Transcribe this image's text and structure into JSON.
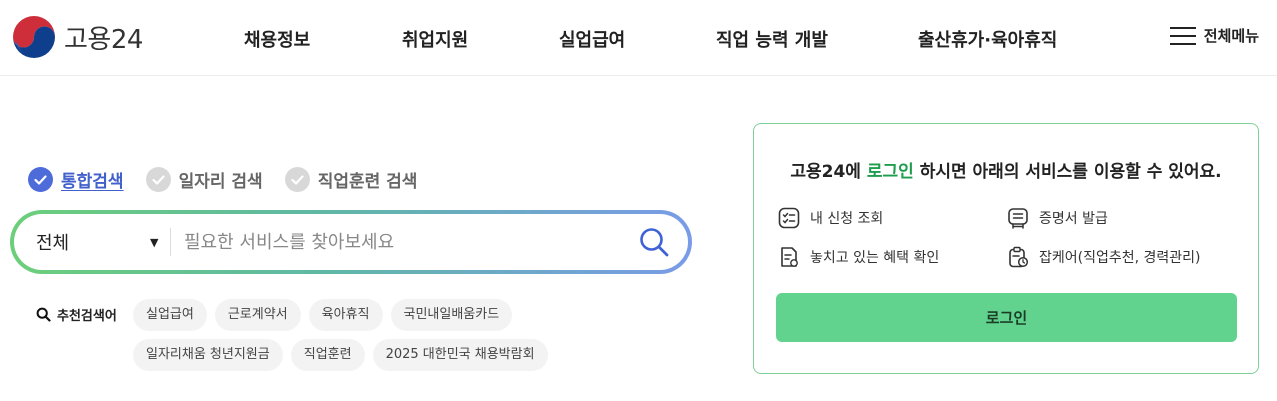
{
  "header": {
    "logo_text": "고용24",
    "nav": [
      {
        "label": "채용정보"
      },
      {
        "label": "취업지원"
      },
      {
        "label": "실업급여"
      },
      {
        "label": "직업 능력 개발"
      },
      {
        "label": "출산휴가·육아휴직"
      }
    ],
    "menu_label": "전체메뉴"
  },
  "search": {
    "tabs": [
      {
        "label": "통합검색",
        "active": true
      },
      {
        "label": "일자리 검색",
        "active": false
      },
      {
        "label": "직업훈련 검색",
        "active": false
      }
    ],
    "category_value": "전체",
    "placeholder": "필요한 서비스를 찾아보세요",
    "recommend_label": "추천검색어",
    "keywords": [
      "실업급여",
      "근로계약서",
      "육아휴직",
      "국민내일배움카드",
      "일자리채움 청년지원금",
      "직업훈련",
      "2025 대한민국 채용박람회"
    ]
  },
  "login_card": {
    "message_prefix": "고용24에 ",
    "message_highlight": "로그인",
    "message_suffix": " 하시면 아래의 서비스를 이용할 수 있어요.",
    "services": [
      {
        "label": "내 신청 조회",
        "icon": "list-check-icon"
      },
      {
        "label": "증명서 발급",
        "icon": "certificate-icon"
      },
      {
        "label": "놓치고 있는 혜택 확인",
        "icon": "benefit-doc-icon"
      },
      {
        "label": "잡케어(직업추천, 경력관리)",
        "icon": "clipboard-clock-icon"
      }
    ],
    "login_button": "로그인",
    "accent_color": "#1e9e4d"
  }
}
